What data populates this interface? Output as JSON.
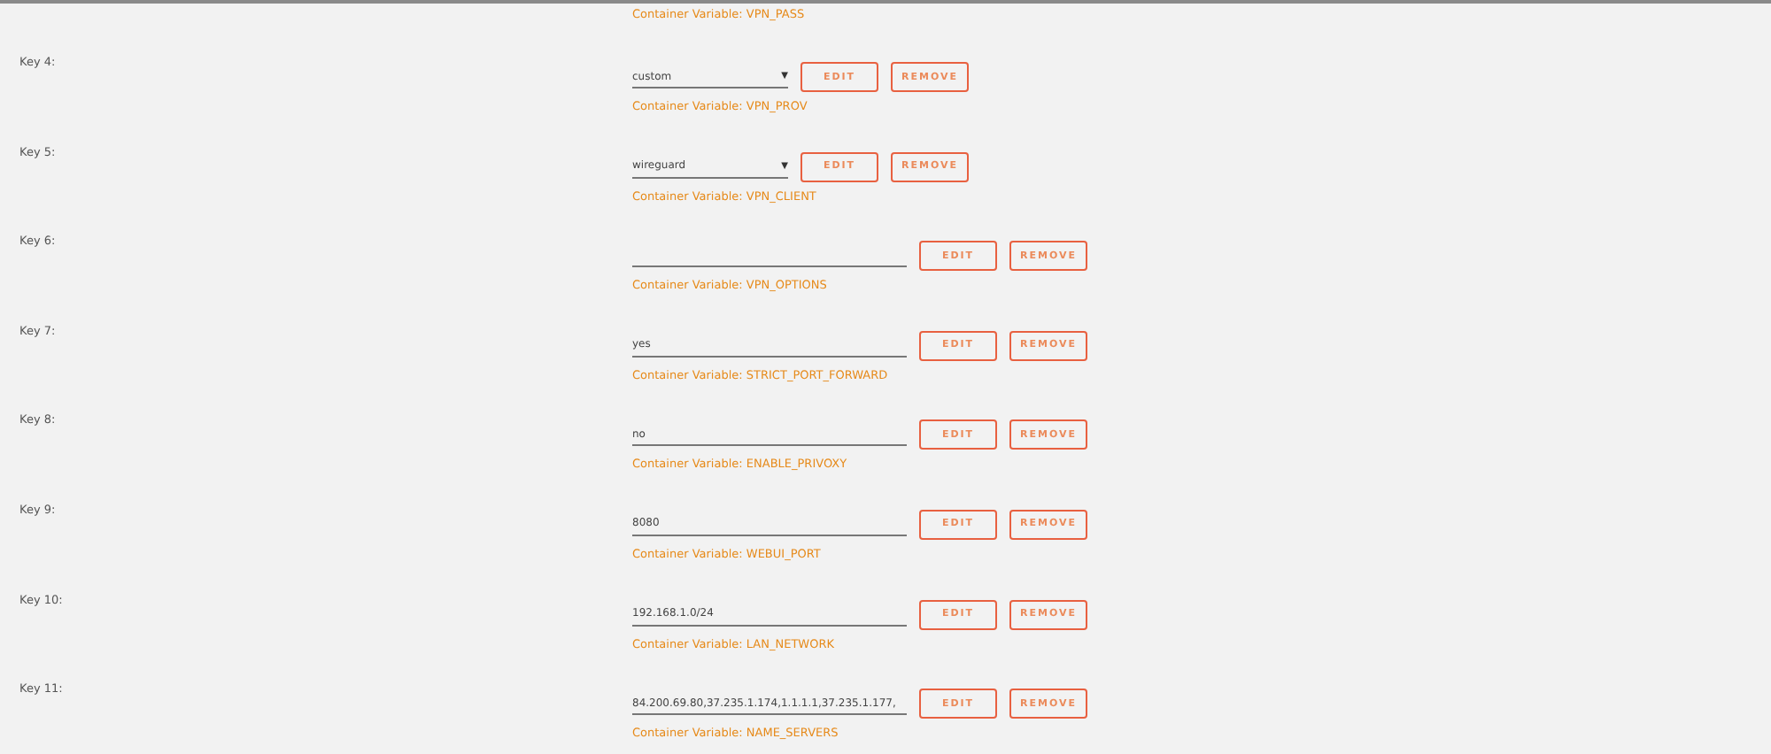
{
  "previous_row": {
    "variable": "Container Variable: VPN_PASS"
  },
  "rows": [
    {
      "key": "Key 4:",
      "kind": "select",
      "value": "custom",
      "arrow": "▼",
      "variable": "Container Variable: VPN_PROV",
      "edit": "EDIT",
      "remove": "REMOVE"
    },
    {
      "key": "Key 5:",
      "kind": "select",
      "value": "wireguard",
      "arrow": "▼",
      "variable": "Container Variable: VPN_CLIENT",
      "edit": "EDIT",
      "remove": "REMOVE"
    },
    {
      "key": "Key 6:",
      "kind": "text",
      "value": "",
      "variable": "Container Variable: VPN_OPTIONS",
      "edit": "EDIT",
      "remove": "REMOVE"
    },
    {
      "key": "Key 7:",
      "kind": "text",
      "value": "yes",
      "variable": "Container Variable: STRICT_PORT_FORWARD",
      "edit": "EDIT",
      "remove": "REMOVE"
    },
    {
      "key": "Key 8:",
      "kind": "text",
      "value": "no",
      "variable": "Container Variable: ENABLE_PRIVOXY",
      "edit": "EDIT",
      "remove": "REMOVE"
    },
    {
      "key": "Key 9:",
      "kind": "text",
      "value": "8080",
      "variable": "Container Variable: WEBUI_PORT",
      "edit": "EDIT",
      "remove": "REMOVE"
    },
    {
      "key": "Key 10:",
      "kind": "text",
      "value": "192.168.1.0/24",
      "variable": "Container Variable: LAN_NETWORK",
      "edit": "EDIT",
      "remove": "REMOVE"
    },
    {
      "key": "Key 11:",
      "kind": "text",
      "value": "84.200.69.80,37.235.1.174,1.1.1.1,37.235.1.177,",
      "variable": "Container Variable: NAME_SERVERS",
      "edit": "EDIT",
      "remove": "REMOVE"
    }
  ]
}
